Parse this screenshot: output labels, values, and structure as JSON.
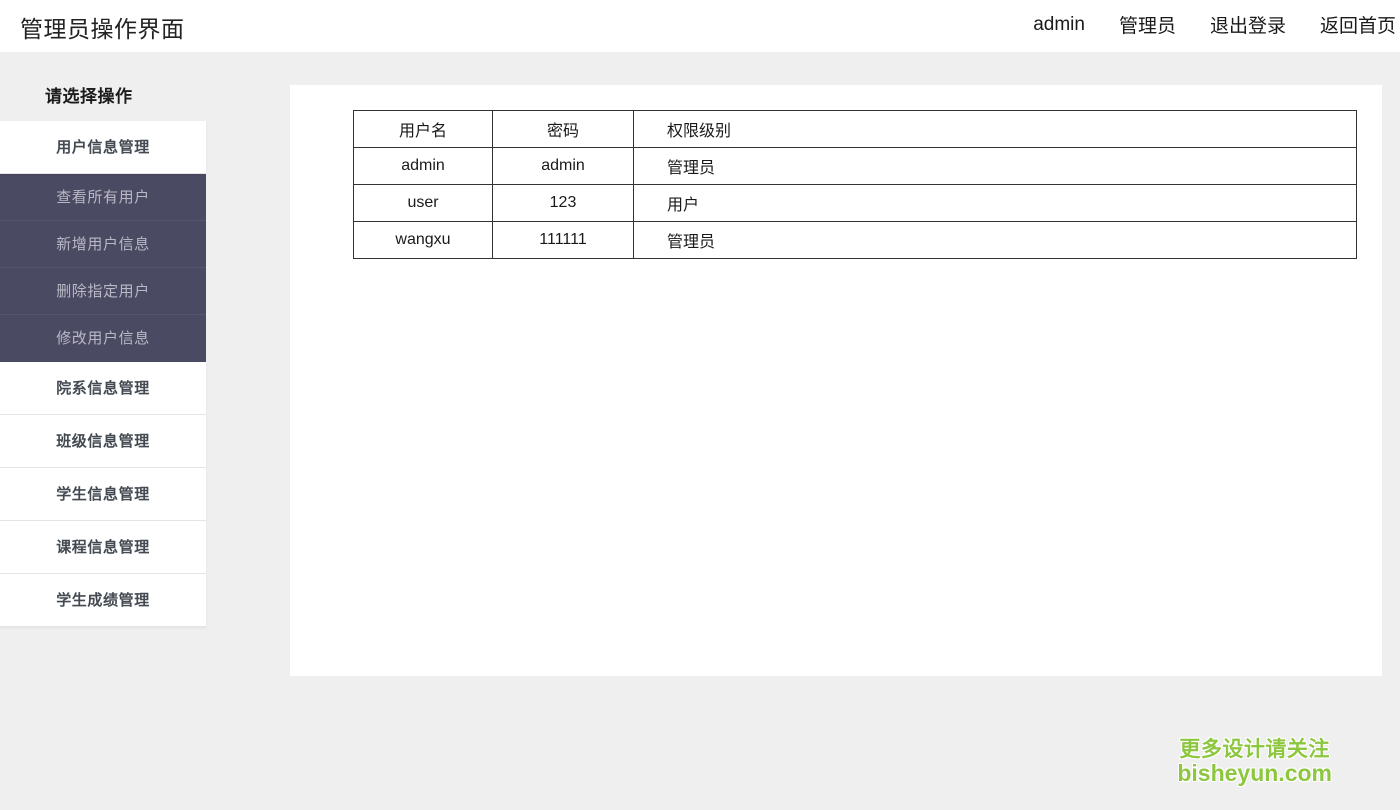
{
  "header": {
    "title": "管理员操作界面",
    "nav": [
      {
        "label": "admin",
        "name": "nav-item-username"
      },
      {
        "label": "管理员",
        "name": "nav-item-role"
      },
      {
        "label": "退出登录",
        "name": "nav-item-logout"
      },
      {
        "label": "返回首页",
        "name": "nav-item-home"
      }
    ]
  },
  "sidebar": {
    "heading": "请选择操作",
    "items": [
      {
        "label": "用户信息管理"
      },
      {
        "label": "院系信息管理"
      },
      {
        "label": "班级信息管理"
      },
      {
        "label": "学生信息管理"
      },
      {
        "label": "课程信息管理"
      },
      {
        "label": "学生成绩管理"
      }
    ],
    "submenu": [
      {
        "label": "查看所有用户"
      },
      {
        "label": "新增用户信息"
      },
      {
        "label": "删除指定用户"
      },
      {
        "label": "修改用户信息"
      }
    ]
  },
  "table": {
    "headers": [
      "用户名",
      "密码",
      "权限级别"
    ],
    "rows": [
      [
        "admin",
        "admin",
        "管理员"
      ],
      [
        "user",
        "123",
        "用户"
      ],
      [
        "wangxu",
        "111111",
        "管理员"
      ]
    ]
  },
  "watermark": {
    "line1": "更多设计请关注",
    "line2": "bisheyun.com",
    "color": "#8dc63f"
  },
  "colors": {
    "page_background": "#efefef",
    "header_background": "#ffffff",
    "submenu_background": "#4b4a63",
    "panel_background": "#ffffff",
    "table_border": "#333333"
  }
}
